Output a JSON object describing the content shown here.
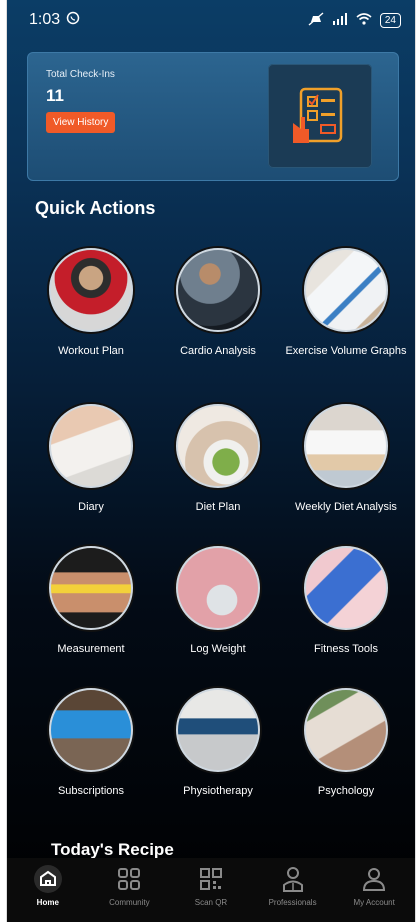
{
  "status_bar": {
    "time": "1:03",
    "battery": "24"
  },
  "checkin_card": {
    "label": "Total Check-Ins",
    "count": "11",
    "history_button": "View History"
  },
  "quick_actions": {
    "title": "Quick Actions",
    "items": [
      {
        "label": "Workout Plan",
        "icon": "workout-photo"
      },
      {
        "label": "Cardio Analysis",
        "icon": "cardio-photo"
      },
      {
        "label": "Exercise Volume Graphs",
        "icon": "graphs-photo"
      },
      {
        "label": "Diary",
        "icon": "diary-photo"
      },
      {
        "label": "Diet Plan",
        "icon": "diet-photo"
      },
      {
        "label": "Weekly Diet Analysis",
        "icon": "diet-analysis-photo"
      },
      {
        "label": "Measurement",
        "icon": "tape-measure-photo"
      },
      {
        "label": "Log Weight",
        "icon": "scale-photo"
      },
      {
        "label": "Fitness Tools",
        "icon": "dumbbell-photo"
      },
      {
        "label": "Subscriptions",
        "icon": "laptop-photo"
      },
      {
        "label": "Physiotherapy",
        "icon": "physio-photo"
      },
      {
        "label": "Psychology",
        "icon": "psychology-photo"
      }
    ]
  },
  "recipe": {
    "title": "Today's Recipe"
  },
  "bottom_nav": {
    "items": [
      {
        "label": "Home",
        "icon": "home-icon"
      },
      {
        "label": "Community",
        "icon": "grid-icon"
      },
      {
        "label": "Scan QR",
        "icon": "qr-icon"
      },
      {
        "label": "Professionals",
        "icon": "doctor-icon"
      },
      {
        "label": "My Account",
        "icon": "user-icon"
      }
    ]
  },
  "colors": {
    "accent": "#f05a28",
    "card": "#245a82",
    "background": "#000000"
  }
}
